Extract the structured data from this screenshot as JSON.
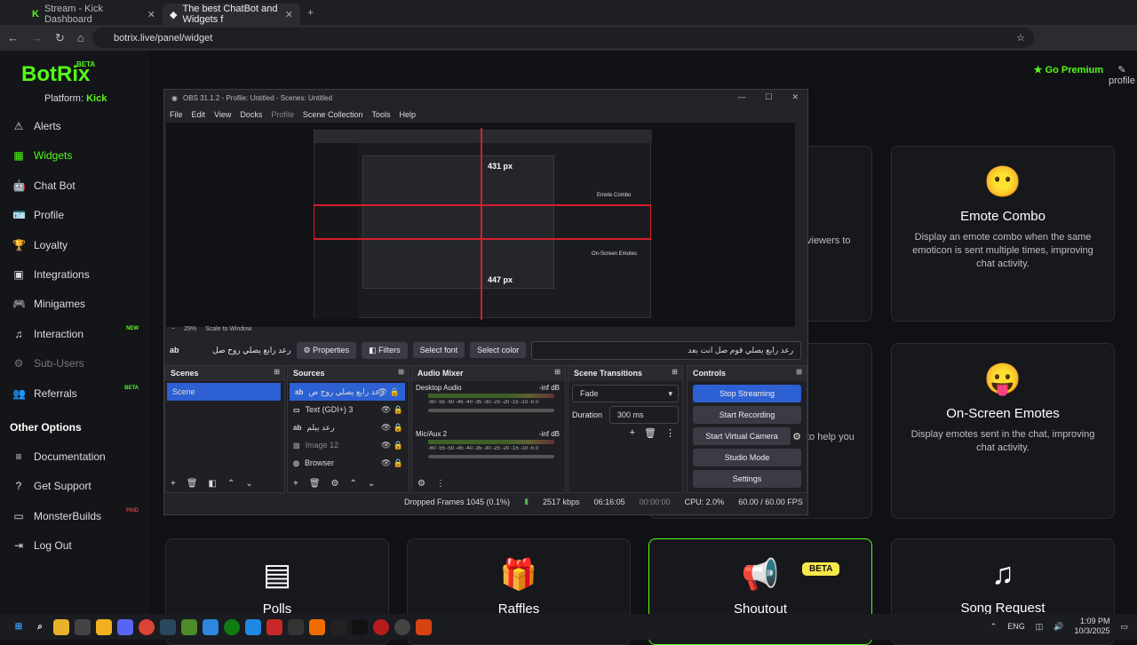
{
  "browser": {
    "tabs": [
      {
        "title": "Stream - Kick Dashboard"
      },
      {
        "title": "The best ChatBot and Widgets f"
      }
    ],
    "url": "botrix.live/panel/widget"
  },
  "app": {
    "brand": "BotRix",
    "brand_badge": "BETA",
    "platform_label": "Platform:",
    "platform_value": "Kick",
    "go_premium": "Go Premium",
    "profile": "profile"
  },
  "sidebar": {
    "items": [
      {
        "label": "Alerts",
        "icon": "⚠"
      },
      {
        "label": "Widgets",
        "icon": "▦"
      },
      {
        "label": "Chat Bot",
        "icon": "🤖"
      },
      {
        "label": "Profile",
        "icon": "🪪"
      },
      {
        "label": "Loyalty",
        "icon": "🏆"
      },
      {
        "label": "Integrations",
        "icon": "▣"
      },
      {
        "label": "Minigames",
        "icon": "🎮"
      },
      {
        "label": "Interaction",
        "icon": "♫",
        "badge": "NEW"
      },
      {
        "label": "Sub-Users",
        "icon": "⚙"
      },
      {
        "label": "Referrals",
        "icon": "👥",
        "badge": "BETA"
      }
    ],
    "other_heading": "Other Options",
    "other_items": [
      {
        "label": "Documentation",
        "icon": "≡"
      },
      {
        "label": "Get Support",
        "icon": "?"
      },
      {
        "label": "MonsterBuilds",
        "icon": "▭",
        "badge": "PAID"
      },
      {
        "label": "Log Out",
        "icon": "⇥"
      }
    ]
  },
  "cards": {
    "emote_combo": {
      "title": "Emote Combo",
      "desc": "Display an emote combo when the same emoticon is sent multiple times, improving chat activity."
    },
    "onscreen_emotes": {
      "title": "On-Screen Emotes",
      "desc": "Display emotes sent in the chat, improving chat activity."
    },
    "polls": {
      "title": "Polls"
    },
    "raffles": {
      "title": "Raffles"
    },
    "shoutout": {
      "title": "Shoutout",
      "badge": "BETA"
    },
    "song_request": {
      "title": "Song Request"
    },
    "fragment_1": "viewers to",
    "fragment_2": "to help you"
  },
  "obs": {
    "title": "OBS 31.1.2 - Profile: Untitled - Scenes: Untitled",
    "menu": [
      "File",
      "Edit",
      "View",
      "Docks",
      "Profile",
      "Scene Collection",
      "Tools",
      "Help"
    ],
    "preview_label_top": "431 px",
    "preview_label_bottom": "447 px",
    "nested_card_1": "Emote Combo",
    "nested_card_2": "On-Screen Emotes",
    "zoom": "29%",
    "scale": "Scale to Window",
    "text_source": "رعد رابع يصلي روح صل",
    "properties": "Properties",
    "filters": "Filters",
    "select_font": "Select font",
    "select_color": "Select color",
    "text_value": "رعد رابع يصلي قوم صل انت بعد",
    "docks": {
      "scenes": "Scenes",
      "sources": "Sources",
      "mixer": "Audio Mixer",
      "transitions": "Scene Transitions",
      "controls": "Controls"
    },
    "scene_items": [
      "Scene"
    ],
    "sources": [
      {
        "name": "رعد رابع يصلي روح ص"
      },
      {
        "name": "Text (GDI+) 3"
      },
      {
        "name": "رعد يبلم"
      },
      {
        "name": "Image 12"
      },
      {
        "name": "Browser"
      }
    ],
    "mixer": [
      {
        "name": "Desktop Audio",
        "level": "-inf dB"
      },
      {
        "name": "Mic/Aux 2",
        "level": "-inf dB"
      }
    ],
    "meter_scale": "-60 -55 -50 -45 -40 -35 -30 -25 -20 -15 -10 -5 0",
    "transition": "Fade",
    "duration_label": "Duration",
    "duration": "300 ms",
    "controls": [
      "Stop Streaming",
      "Start Recording",
      "Start Virtual Camera",
      "Studio Mode",
      "Settings"
    ],
    "status": {
      "dropped": "Dropped Frames 1045 (0.1%)",
      "bitrate": "2517 kbps",
      "stream_time": "06:16:05",
      "rec_time": "00:00:00",
      "cpu": "CPU: 2.0%",
      "fps": "60.00 / 60.00 FPS"
    }
  },
  "taskbar": {
    "lang": "ENG",
    "time": "1:09 PM",
    "date": "10/3/2025"
  },
  "colors": {
    "accent": "#53fc18",
    "stream_btn": "#2d60d2",
    "beta_pill": "#f6e84b"
  }
}
